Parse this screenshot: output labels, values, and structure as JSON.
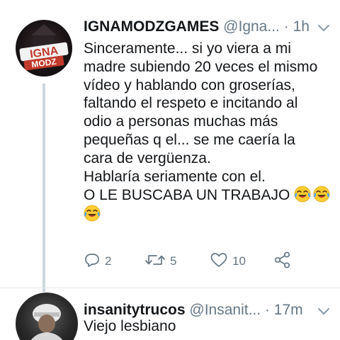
{
  "tweets": [
    {
      "avatar_text": "IGNA MODZ",
      "display_name": "IGNAMODZGAMES",
      "handle": "@Igna...",
      "separator": "·",
      "time": "1h",
      "text_lines": [
        "Sinceramente... si yo viera a mi",
        "madre subiendo 20 veces el mismo",
        "vídeo y hablando con groserías,",
        "faltando el respeto e incitando al",
        "odio a personas muchas más",
        "pequeñas q el... se me caería la",
        "cara de vergüenza.",
        "Hablaría seriamente con el.",
        "O LE BUSCABA UN TRABAJO"
      ],
      "emoji": "face-with-tears-of-joy",
      "actions": {
        "reply_count": "2",
        "retweet_count": "5",
        "like_count": "10"
      }
    },
    {
      "display_name": "insanitytrucos",
      "handle": "@Insanit...",
      "separator": "·",
      "time": "17m",
      "text": "Viejo lesbiano"
    }
  ],
  "colors": {
    "text": "#14171a",
    "secondary": "#657786",
    "thread_line": "#ccd6dd"
  },
  "icons": [
    "reply-icon",
    "retweet-icon",
    "like-icon",
    "share-icon",
    "chevron-down-icon",
    "face-with-tears-of-joy-emoji"
  ]
}
